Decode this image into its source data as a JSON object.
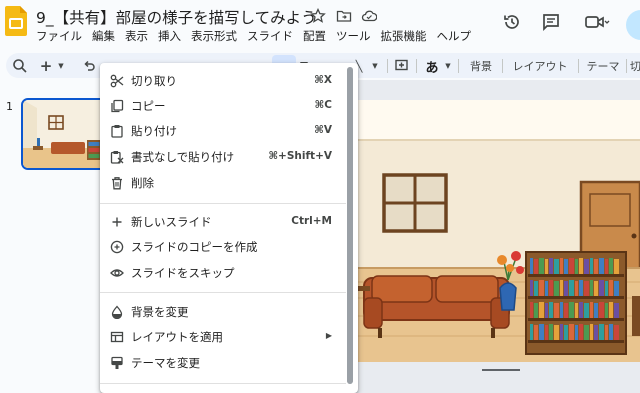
{
  "header": {
    "title": "9_【共有】部屋の様子を描写してみよう",
    "menus": [
      "ファイル",
      "編集",
      "表示",
      "挿入",
      "表示形式",
      "スライド",
      "配置",
      "ツール",
      "拡張機能",
      "ヘルプ"
    ],
    "icons": [
      "star-icon",
      "move-to-folder-icon",
      "cloud-saved-icon",
      "history-icon",
      "comments-icon",
      "meet-icon"
    ]
  },
  "toolbar": {
    "text_style_label": "あ",
    "background_label": "背景",
    "layout_label": "レイアウト",
    "theme_label": "テーマ",
    "partial_label": "切"
  },
  "filmstrip": {
    "slide_number": "1"
  },
  "context_menu": {
    "groups": [
      [
        {
          "label": "切り取り",
          "shortcut": "⌘X",
          "icon": "cut-icon"
        },
        {
          "label": "コピー",
          "shortcut": "⌘C",
          "icon": "copy-icon"
        },
        {
          "label": "貼り付け",
          "shortcut": "⌘V",
          "icon": "paste-icon"
        },
        {
          "label": "書式なしで貼り付け",
          "shortcut": "⌘+Shift+V",
          "icon": "paste-plain-icon"
        },
        {
          "label": "削除",
          "shortcut": "",
          "icon": "trash-icon"
        }
      ],
      [
        {
          "label": "新しいスライド",
          "shortcut": "Ctrl+M",
          "icon": "plus-icon"
        },
        {
          "label": "スライドのコピーを作成",
          "shortcut": "",
          "icon": "duplicate-icon"
        },
        {
          "label": "スライドをスキップ",
          "shortcut": "",
          "icon": "eye-icon"
        }
      ],
      [
        {
          "label": "背景を変更",
          "shortcut": "",
          "icon": "fill-icon"
        },
        {
          "label": "レイアウトを適用",
          "shortcut": "",
          "icon": "layout-icon",
          "submenu": true
        },
        {
          "label": "テーマを変更",
          "shortcut": "",
          "icon": "theme-icon"
        }
      ]
    ]
  },
  "colors": {
    "accent": "#0b57d0",
    "logo": "#f5ba14",
    "menu_bg": "#ffffff",
    "toolbar_bg": "#edf2fa"
  }
}
